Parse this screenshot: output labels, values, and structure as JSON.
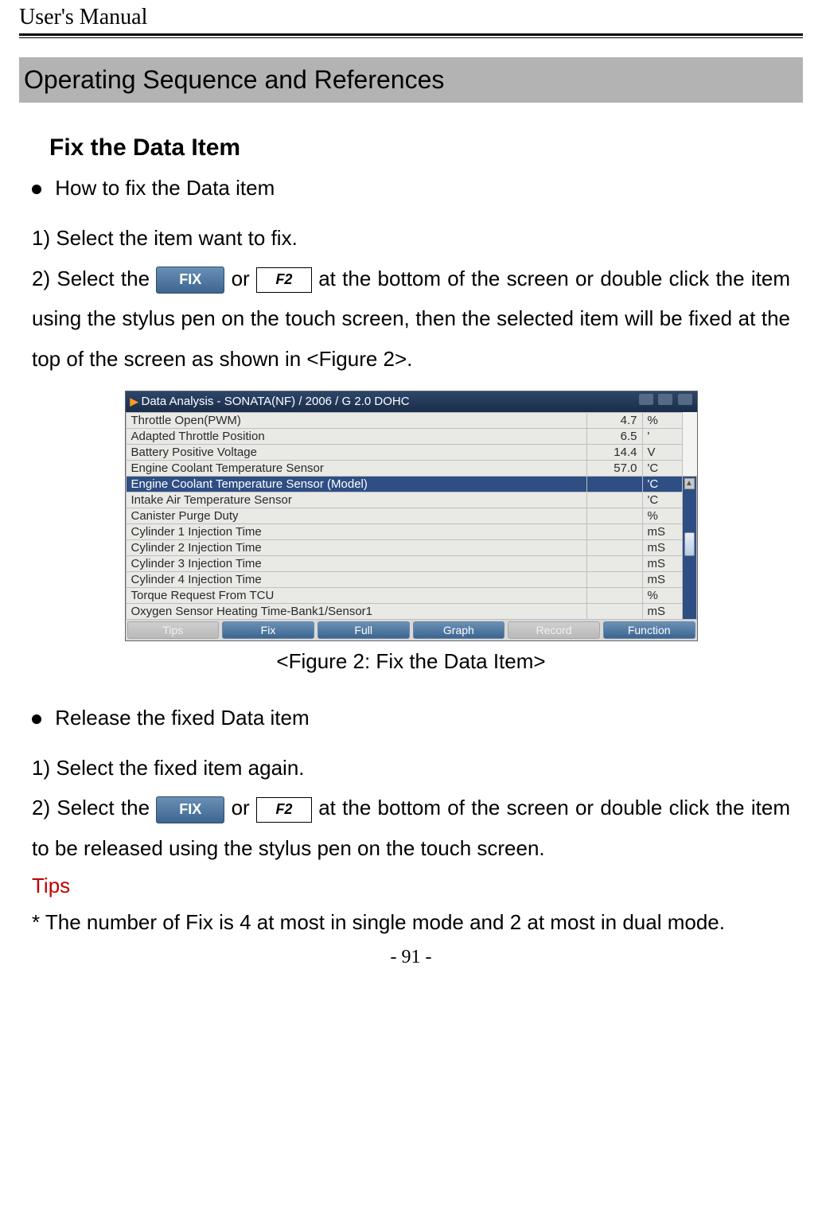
{
  "running_head": "User's Manual",
  "page_number": "- 91 -",
  "h1": "Operating Sequence and References",
  "section1": {
    "heading": "Fix the Data Item",
    "bullet": "How to fix the Data item",
    "step1": "1) Select the item want to fix.",
    "step2a": "2) Select the ",
    "fix_btn": "FIX",
    "or": " or ",
    "f2_key": "F2",
    "step2b": " at the bottom of the screen or double click the item using the stylus pen on the touch screen, then the selected item will be fixed at the top of the screen as shown in <Figure 2>."
  },
  "figure": {
    "title": "Data Analysis - SONATA(NF) / 2006 / G 2.0 DOHC",
    "rows_top": [
      {
        "name": "Throttle Open(PWM)",
        "val": "4.7",
        "unit": "%"
      },
      {
        "name": "Adapted Throttle Position",
        "val": "6.5",
        "unit": "'"
      },
      {
        "name": "Battery Positive Voltage",
        "val": "14.4",
        "unit": "V"
      },
      {
        "name": "Engine Coolant Temperature Sensor",
        "val": "57.0",
        "unit": "'C"
      }
    ],
    "row_sel": {
      "name": "Engine Coolant Temperature Sensor (Model)",
      "val": "",
      "unit": "'C"
    },
    "rows_rest": [
      {
        "name": "Intake Air Temperature Sensor",
        "val": "",
        "unit": "'C"
      },
      {
        "name": "Canister Purge Duty",
        "val": "",
        "unit": "%"
      },
      {
        "name": "Cylinder 1 Injection Time",
        "val": "",
        "unit": "mS"
      },
      {
        "name": "Cylinder 2 Injection Time",
        "val": "",
        "unit": "mS"
      },
      {
        "name": "Cylinder 3 Injection Time",
        "val": "",
        "unit": "mS"
      },
      {
        "name": "Cylinder 4 Injection Time",
        "val": "",
        "unit": "mS"
      },
      {
        "name": "Torque Request From TCU",
        "val": "",
        "unit": "%"
      },
      {
        "name": "Oxygen Sensor Heating Time-Bank1/Sensor1",
        "val": "",
        "unit": "mS"
      }
    ],
    "toolbar": [
      "Tips",
      "Fix",
      "Full",
      "Graph",
      "Record",
      "Function"
    ],
    "caption": "<Figure 2: Fix the Data Item>"
  },
  "section2": {
    "bullet": "Release the fixed Data item",
    "step1": "1) Select the fixed item again.",
    "step2a": "2) Select the ",
    "fix_btn": "FIX",
    "or": " or ",
    "f2_key": "F2",
    "step2b": " at the bottom of the screen or double click the item to be released using the stylus pen on the touch screen."
  },
  "tips_label": "Tips",
  "tips_body": "* The number of Fix is 4 at most in single mode and 2 at most in dual mode."
}
